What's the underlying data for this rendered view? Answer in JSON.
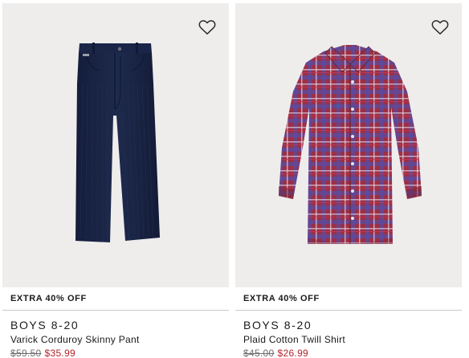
{
  "products": [
    {
      "promo": "EXTRA 40% OFF",
      "category": "BOYS 8-20",
      "name": "Varick Corduroy Skinny Pant",
      "original_price": "$59.50",
      "sale_price": "$35.99",
      "image_icon": "navy-corduroy-pants-icon",
      "wishlist_icon": "heart-outline-icon"
    },
    {
      "promo": "EXTRA 40% OFF",
      "category": "BOYS 8-20",
      "name": "Plaid Cotton Twill Shirt",
      "original_price": "$45.00",
      "sale_price": "$26.99",
      "image_icon": "red-plaid-shirt-icon",
      "wishlist_icon": "heart-outline-icon"
    }
  ],
  "colors": {
    "image_background": "#eeedec",
    "sale_price": "#b3232b",
    "original_price": "#6e6e6e",
    "divider": "#c9c9c9"
  }
}
